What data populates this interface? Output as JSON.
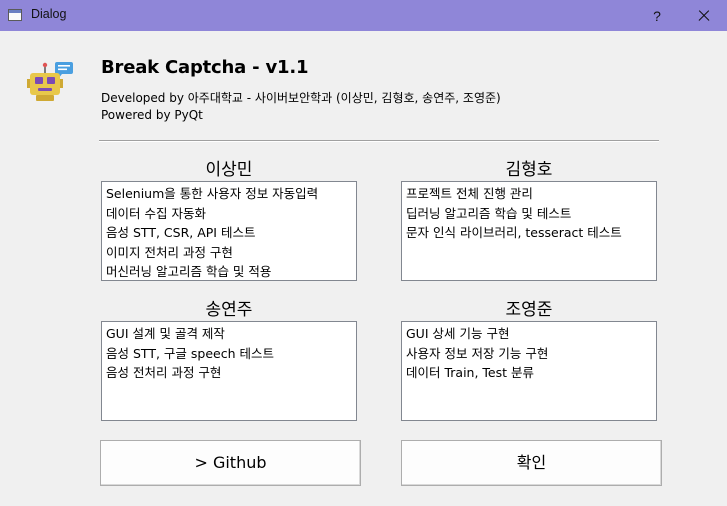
{
  "window": {
    "title": "Dialog",
    "help_label": "?"
  },
  "app": {
    "title": "Break Captcha - v1.1",
    "developed_by": "Developed by 아주대학교 - 사이버보안학과 (이상민, 김형호, 송연주, 조영준)",
    "powered_by": "Powered by PyQt",
    "logo_icon": "robot-chat-icon",
    "colors": {
      "titlebar": "#8f86d8",
      "robot_face": "#e8c84a",
      "robot_eyes": "#7b4bb5",
      "bubble": "#4a9fe0"
    }
  },
  "members": [
    {
      "name": "이상민",
      "tasks": [
        "Selenium을 통한 사용자 정보 자동입력",
        "데이터 수집 자동화",
        "음성 STT, CSR, API 테스트",
        "이미지 전처리 과정 구현",
        "머신러닝 알고리즘 학습 및 적용"
      ]
    },
    {
      "name": "김형호",
      "tasks": [
        "프로젝트 전체 진행 관리",
        "딥러닝 알고리즘 학습 및 테스트",
        "문자 인식 라이브러리, tesseract 테스트"
      ]
    },
    {
      "name": "송연주",
      "tasks": [
        "GUI 설계 및 골격 제작",
        "음성 STT, 구글 speech 테스트",
        "음성 전처리 과정 구현"
      ]
    },
    {
      "name": "조영준",
      "tasks": [
        "GUI 상세 기능 구현",
        "사용자 정보 저장 기능 구현",
        "데이터 Train, Test 분류"
      ]
    }
  ],
  "buttons": {
    "github": "> Github",
    "confirm": "확인"
  }
}
